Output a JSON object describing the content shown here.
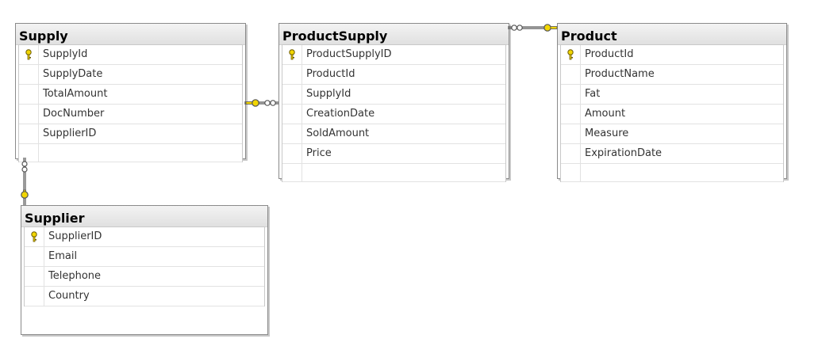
{
  "tables": {
    "supply": {
      "title": "Supply",
      "columns": [
        "SupplyId",
        "SupplyDate",
        "TotalAmount",
        "DocNumber",
        "SupplierID"
      ]
    },
    "productsupply": {
      "title": "ProductSupply",
      "columns": [
        "ProductSupplyID",
        "ProductId",
        "SupplyId",
        "CreationDate",
        "SoldAmount",
        "Price"
      ]
    },
    "product": {
      "title": "Product",
      "columns": [
        "ProductId",
        "ProductName",
        "Fat",
        "Amount",
        "Measure",
        "ExpirationDate"
      ]
    },
    "supplier": {
      "title": "Supplier",
      "columns": [
        "SupplierID",
        "Email",
        "Telephone",
        "Country"
      ]
    }
  },
  "relationships": [
    {
      "from": "ProductSupply",
      "to": "Product",
      "many_side": "ProductSupply",
      "one_side": "Product"
    },
    {
      "from": "ProductSupply",
      "to": "Supply",
      "many_side": "ProductSupply",
      "one_side": "Supply"
    },
    {
      "from": "Supply",
      "to": "Supplier",
      "many_side": "Supply",
      "one_side": "Supplier"
    }
  ],
  "colors": {
    "key": "#f2d600",
    "border": "#8a8a8a",
    "link": "#555555"
  },
  "icons": {
    "primary_key": "key-icon",
    "many_end": "infinity-icon",
    "one_end": "key-icon"
  }
}
